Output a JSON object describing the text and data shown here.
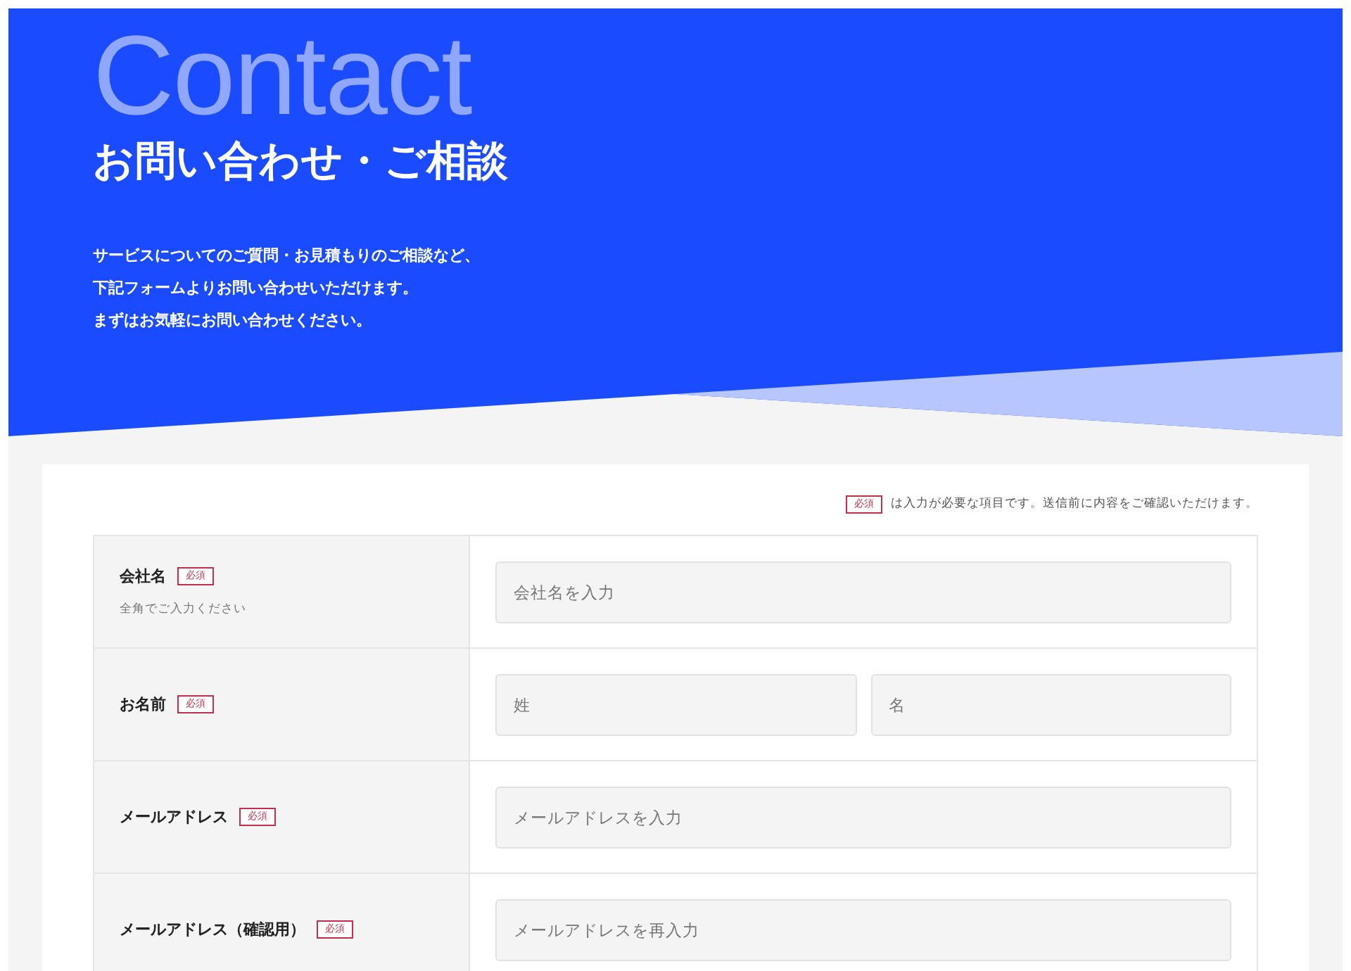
{
  "hero": {
    "bg_text": "Contact",
    "title": "お問い合わせ・ご相談",
    "lead": [
      "サービスについてのご質問・お見積もりのご相談など、",
      "下記フォームよりお問い合わせいただけます。",
      "まずはお気軽にお問い合わせください。"
    ]
  },
  "notice": {
    "badge": "必須",
    "text": "は入力が必要な項目です。送信前に内容をご確認いただけます。"
  },
  "fields": [
    {
      "label": "会社名",
      "badge": "必須",
      "note": "全角でご入力ください",
      "placeholders": [
        "会社名を入力"
      ]
    },
    {
      "label": "お名前",
      "badge": "必須",
      "placeholders": [
        "姓",
        "名"
      ]
    },
    {
      "label": "メールアドレス",
      "badge": "必須",
      "placeholders": [
        "メールアドレスを入力"
      ]
    },
    {
      "label": "メールアドレス（確認用）",
      "badge": "必須",
      "placeholders": [
        "メールアドレスを再入力"
      ]
    }
  ]
}
